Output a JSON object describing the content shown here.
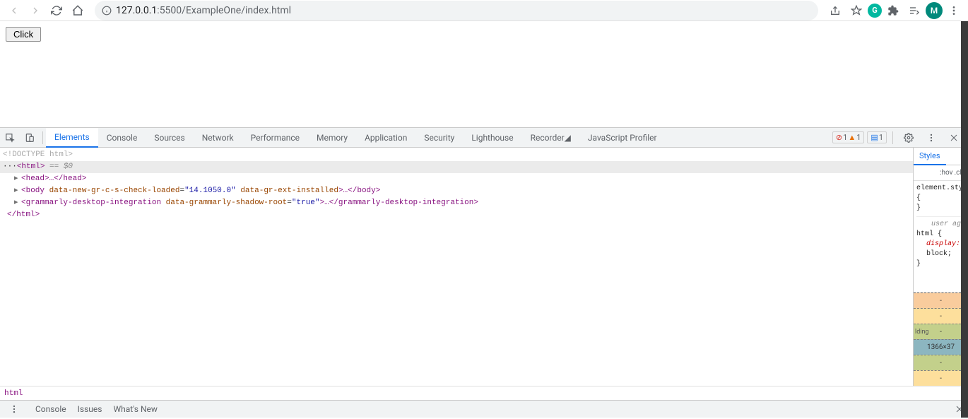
{
  "browser": {
    "url_host": "127.0.0.1",
    "url_port": ":5500",
    "url_path": "/ExampleOne/index.html",
    "profile_initial": "M",
    "ext_initial": "G"
  },
  "page": {
    "click_button": "Click"
  },
  "devtools": {
    "tabs": [
      "Elements",
      "Console",
      "Sources",
      "Network",
      "Performance",
      "Memory",
      "Application",
      "Security",
      "Lighthouse",
      "Recorder",
      "JavaScript Profiler"
    ],
    "active_tab": "Elements",
    "errors": "1",
    "warnings": "1",
    "messages": "1",
    "dom": {
      "doctype": "<!DOCTYPE html>",
      "html_open": "<html>",
      "eq0": " == $0",
      "head": "<head>…</head>",
      "body_open_tag": "body",
      "body_attr1_name": "data-new-gr-c-s-check-loaded",
      "body_attr1_val": "\"14.1050.0\"",
      "body_attr2_name": "data-gr-ext-installed",
      "body_close": "…</body>",
      "grammarly_tag": "grammarly-desktop-integration",
      "grammarly_attr_name": "data-grammarly-shadow-root",
      "grammarly_attr_val": "\"true\"",
      "grammarly_close": "…</grammarly-desktop-integration>",
      "html_close": "</html>"
    },
    "breadcrumb": "html",
    "styles": {
      "tab": "Styles",
      "hov": ":hov",
      "cls": ".cls",
      "element_style": "element.style {",
      "brace_close": "}",
      "user_agent": "user ag…",
      "html_sel": "html {",
      "display_prop": "display:",
      "display_val": "block;",
      "box_dims": "1366×37",
      "padding_label": "lding",
      "dash": "-"
    }
  },
  "drawer": {
    "tabs": [
      "Console",
      "Issues",
      "What's New"
    ]
  }
}
